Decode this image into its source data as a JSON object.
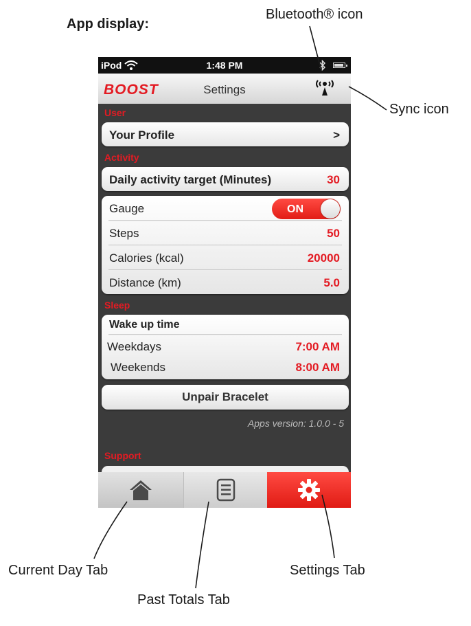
{
  "doc": {
    "title": "App display:",
    "callouts": {
      "bluetooth": "Bluetooth® icon",
      "sync": "Sync icon",
      "current_day_tab": "Current Day Tab",
      "settings_tab": "Settings Tab",
      "past_totals_tab": "Past Totals Tab"
    }
  },
  "status_bar": {
    "carrier": "iPod",
    "time": "1:48 PM",
    "icons": [
      "wifi-icon",
      "bluetooth-icon",
      "battery-icon"
    ]
  },
  "nav": {
    "brand": "BOOST",
    "title": "Settings",
    "sync_icon": "sync-icon"
  },
  "sections": {
    "user": "User",
    "activity": "Activity",
    "sleep": "Sleep",
    "support": "Support"
  },
  "user": {
    "profile_label": "Your Profile",
    "chevron": ">"
  },
  "activity": {
    "target_label": "Daily activity target (Minutes)",
    "target_value": "30",
    "gauge_label": "Gauge",
    "gauge_toggle": "ON",
    "gauge_on": true,
    "steps_label": "Steps",
    "steps_value": "50",
    "calories_label": "Calories (kcal)",
    "calories_value": "20000",
    "distance_label": "Distance (km)",
    "distance_value": "5.0"
  },
  "sleep": {
    "wake_title": "Wake up time",
    "weekdays_label": "Weekdays",
    "weekdays_value": "7:00 AM",
    "weekends_label": "Weekends",
    "weekends_value": "8:00 AM"
  },
  "unpair_label": "Unpair Bracelet",
  "version": "Apps version: 1.0.0 - 5",
  "tabs": {
    "selected": "settings",
    "icons": [
      "home-icon",
      "list-icon",
      "gear-icon"
    ]
  },
  "colors": {
    "accent": "#e31b23",
    "background": "#3b3b3b"
  }
}
